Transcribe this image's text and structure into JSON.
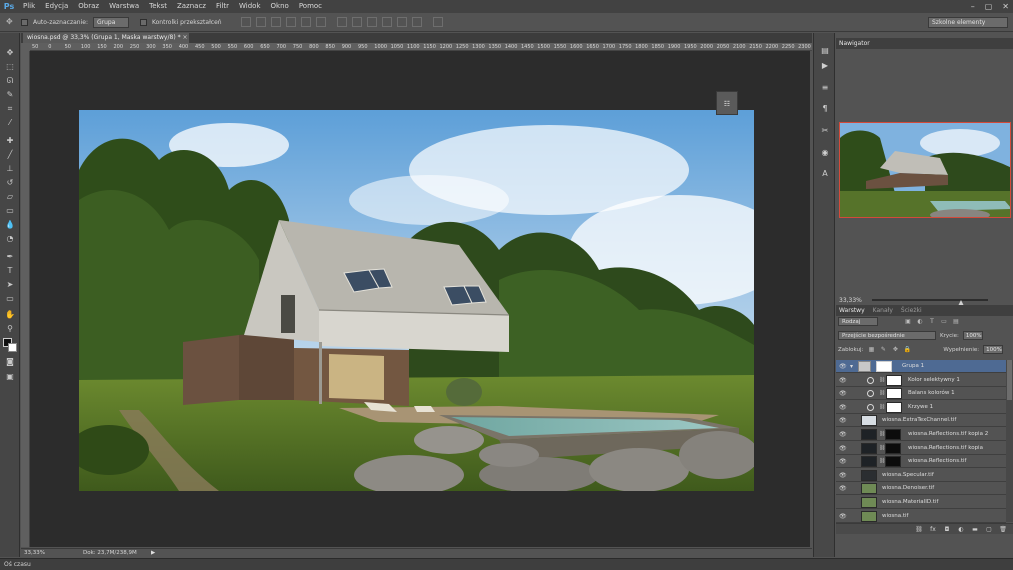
{
  "app": {
    "logo": "Ps",
    "menu": [
      "Plik",
      "Edycja",
      "Obraz",
      "Warstwa",
      "Tekst",
      "Zaznacz",
      "Filtr",
      "Widok",
      "Okno",
      "Pomoc"
    ],
    "window_controls": [
      "–",
      "▢",
      "✕"
    ]
  },
  "options": {
    "auto_select_label": "Auto-zaznaczanie:",
    "auto_select_value": "Grupa",
    "transform_label": "Kontrolki przekształceń",
    "workspace": "Szkolne elementy"
  },
  "document": {
    "tab_title": "wiosna.psd @ 33,3% (Grupa 1, Maska warstwy/8) *",
    "zoom": "33,33%",
    "doc_info": "Dok: 23,7M/238,9M",
    "ruler_labels": [
      "50",
      "0",
      "50",
      "100",
      "150",
      "200",
      "250",
      "300",
      "350",
      "400",
      "450",
      "500",
      "550",
      "600",
      "650",
      "700",
      "750",
      "800",
      "850",
      "900",
      "950",
      "1000",
      "1050",
      "1100",
      "1150",
      "1200",
      "1250",
      "1300",
      "1350",
      "1400",
      "1450",
      "1500",
      "1550",
      "1600",
      "1650",
      "1700",
      "1750",
      "1800",
      "1850",
      "1900",
      "1950",
      "2000",
      "2050",
      "2100",
      "2150",
      "2200",
      "2250",
      "2300",
      "2350",
      "2400",
      "2450",
      "2500",
      "2550",
      "2600",
      "2650",
      "2700",
      "2750",
      "2800",
      "2850",
      "2900",
      "2950",
      "3000",
      "3050",
      "3100",
      "3150",
      "3200",
      "3250",
      "3300",
      "3350",
      "3400",
      "3450",
      "3500",
      "3550",
      "3600",
      "3650",
      "3700",
      "3750",
      "3800",
      "3850",
      "3900",
      "3950",
      "4000"
    ]
  },
  "timeline": {
    "label": "Oś czasu"
  },
  "navigator": {
    "tab": "Nawigator",
    "zoom": "33,33%"
  },
  "layers_panel": {
    "tabs": [
      "Warstwy",
      "Kanały",
      "Ścieżki"
    ],
    "kind_filter": "Rodzaj",
    "blend_mode": "Przejście bezpośrednie",
    "opacity_label": "Krycie:",
    "opacity_value": "100%",
    "lock_label": "Zablokuj:",
    "fill_label": "Wypełnienie:",
    "fill_value": "100%",
    "layers": [
      {
        "name": "Grupa 1",
        "type": "group",
        "visible": true,
        "selected": true
      },
      {
        "name": "Kolor selektywny 1",
        "type": "adjustment",
        "visible": true
      },
      {
        "name": "Balans kolorów 1",
        "type": "adjustment",
        "visible": true
      },
      {
        "name": "Krzywe 1",
        "type": "adjustment",
        "visible": true
      },
      {
        "name": "wiosna.ExtraTexChannel.tif",
        "type": "image",
        "visible": true
      },
      {
        "name": "wiosna.Reflections.tif kopia 2",
        "type": "image-mask",
        "visible": true
      },
      {
        "name": "wiosna.Reflections.tif kopia",
        "type": "image-mask",
        "visible": true
      },
      {
        "name": "wiosna.Reflections.tif",
        "type": "image-mask",
        "visible": true
      },
      {
        "name": "wiosna.Specular.tif",
        "type": "image",
        "visible": true
      },
      {
        "name": "wiosna.Denoiser.tif",
        "type": "image",
        "visible": true
      },
      {
        "name": "wiosna.MaterialID.tif",
        "type": "image",
        "visible": false
      },
      {
        "name": "wiosna.tif",
        "type": "image",
        "visible": true
      }
    ],
    "footer_icons": [
      "link-icon",
      "fx-icon",
      "mask-icon",
      "adjustment-icon",
      "folder-icon",
      "new-layer-icon",
      "trash-icon"
    ]
  },
  "colors": {
    "accent_selection": "#4e6a93",
    "navigator_frame": "#d44a3a",
    "logo": "#5aa9e6"
  }
}
